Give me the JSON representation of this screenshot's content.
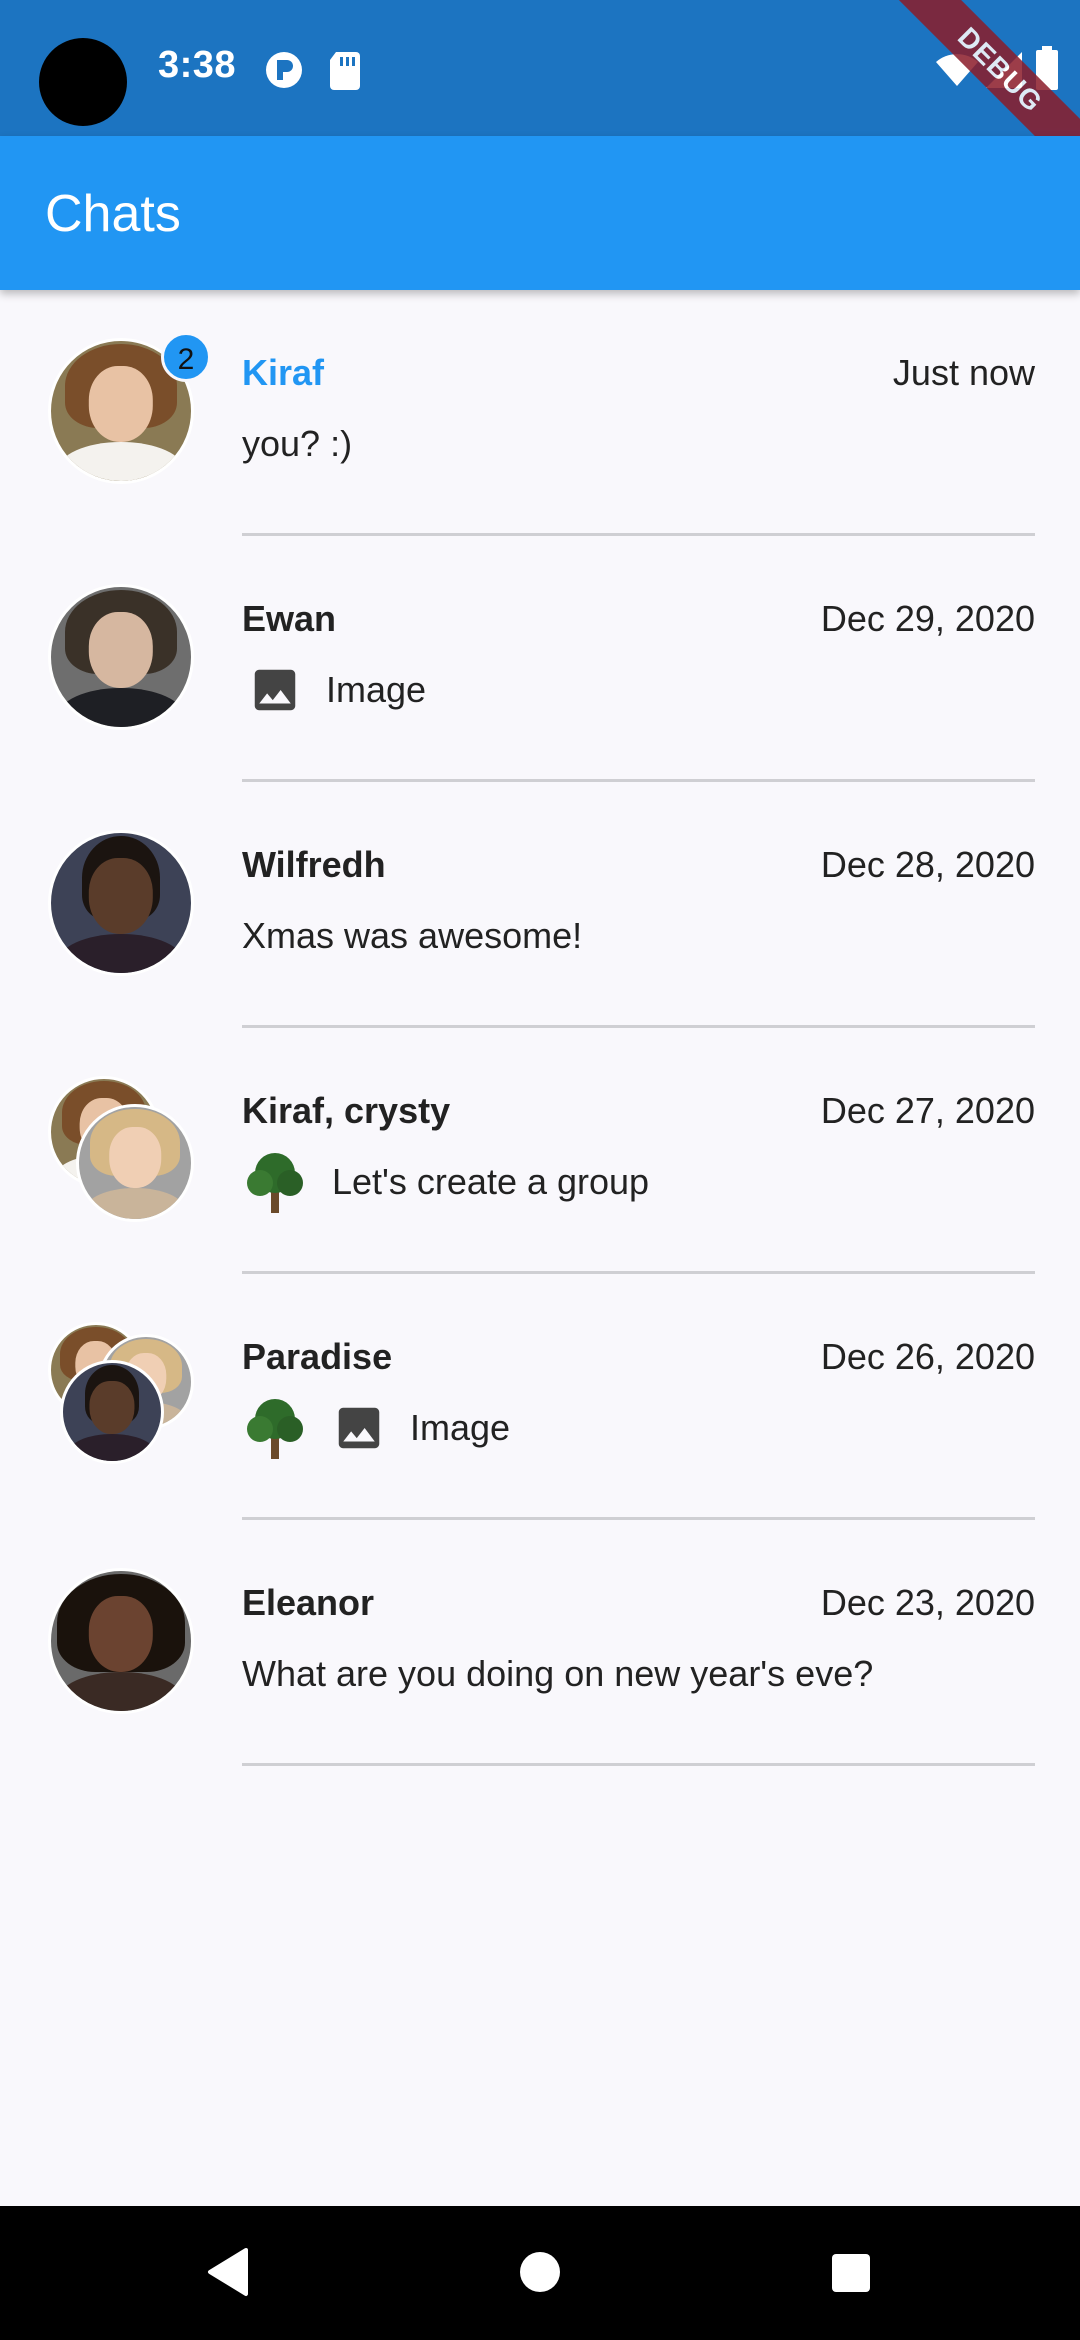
{
  "status": {
    "time": "3:38",
    "debug_label": "DEBUG"
  },
  "app_bar": {
    "title": "Chats"
  },
  "chats": [
    {
      "name": "Kiraf",
      "time": "Just now",
      "preview": "you? :)",
      "unread_count": "2",
      "unread": true
    },
    {
      "name": "Ewan",
      "time": "Dec 29, 2020",
      "preview": "Image",
      "preview_icon": "image-icon"
    },
    {
      "name": "Wilfredh",
      "time": "Dec 28, 2020",
      "preview": "Xmas was awesome!"
    },
    {
      "name": "Kiraf, crysty",
      "time": "Dec 27, 2020",
      "preview": "Let's create a group",
      "preview_icon": "tree-icon"
    },
    {
      "name": "Paradise",
      "time": "Dec 26, 2020",
      "preview": "Image",
      "preview_icons": [
        "tree-icon",
        "image-icon"
      ]
    },
    {
      "name": "Eleanor",
      "time": "Dec 23, 2020",
      "preview": "What are you doing on new year's eve?"
    }
  ],
  "colors": {
    "status_bar": "#1c74c1",
    "app_bar": "#2196f3",
    "accent": "#2196f3",
    "background": "#f9f8fc"
  }
}
